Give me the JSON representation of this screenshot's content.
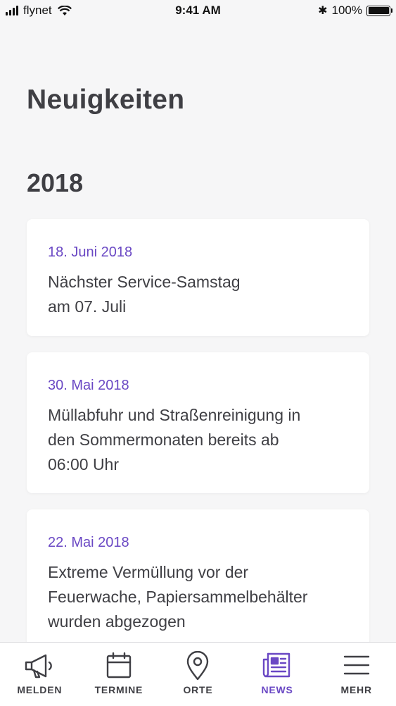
{
  "status_bar": {
    "carrier": "flynet",
    "time": "9:41 AM",
    "battery": "100%",
    "bluetooth_glyph": "✱"
  },
  "page": {
    "title": "Neuigkeiten",
    "year": "2018"
  },
  "news": [
    {
      "date": "18. Juni 2018",
      "title_lines": [
        "Nächster Service-Samstag",
        "am 07. Juli"
      ]
    },
    {
      "date": "30. Mai 2018",
      "title_lines": [
        "Müllabfuhr und Straßenreinigung in",
        "den Sommermonaten bereits ab",
        "06:00 Uhr"
      ]
    },
    {
      "date": "22. Mai 2018",
      "title_lines": [
        "Extreme Vermüllung vor der",
        "Feuerwache, Papiersammelbehälter",
        "wurden abgezogen"
      ]
    }
  ],
  "tabs": [
    {
      "label": "MELDEN",
      "icon": "megaphone-icon"
    },
    {
      "label": "TERMINE",
      "icon": "calendar-icon"
    },
    {
      "label": "ORTE",
      "icon": "location-pin-icon"
    },
    {
      "label": "NEWS",
      "icon": "newspaper-icon",
      "active": true
    },
    {
      "label": "MEHR",
      "icon": "menu-icon"
    }
  ],
  "colors": {
    "accent": "#6a48c4",
    "text": "#3f3f44",
    "background": "#f6f6f7",
    "card": "#ffffff"
  }
}
